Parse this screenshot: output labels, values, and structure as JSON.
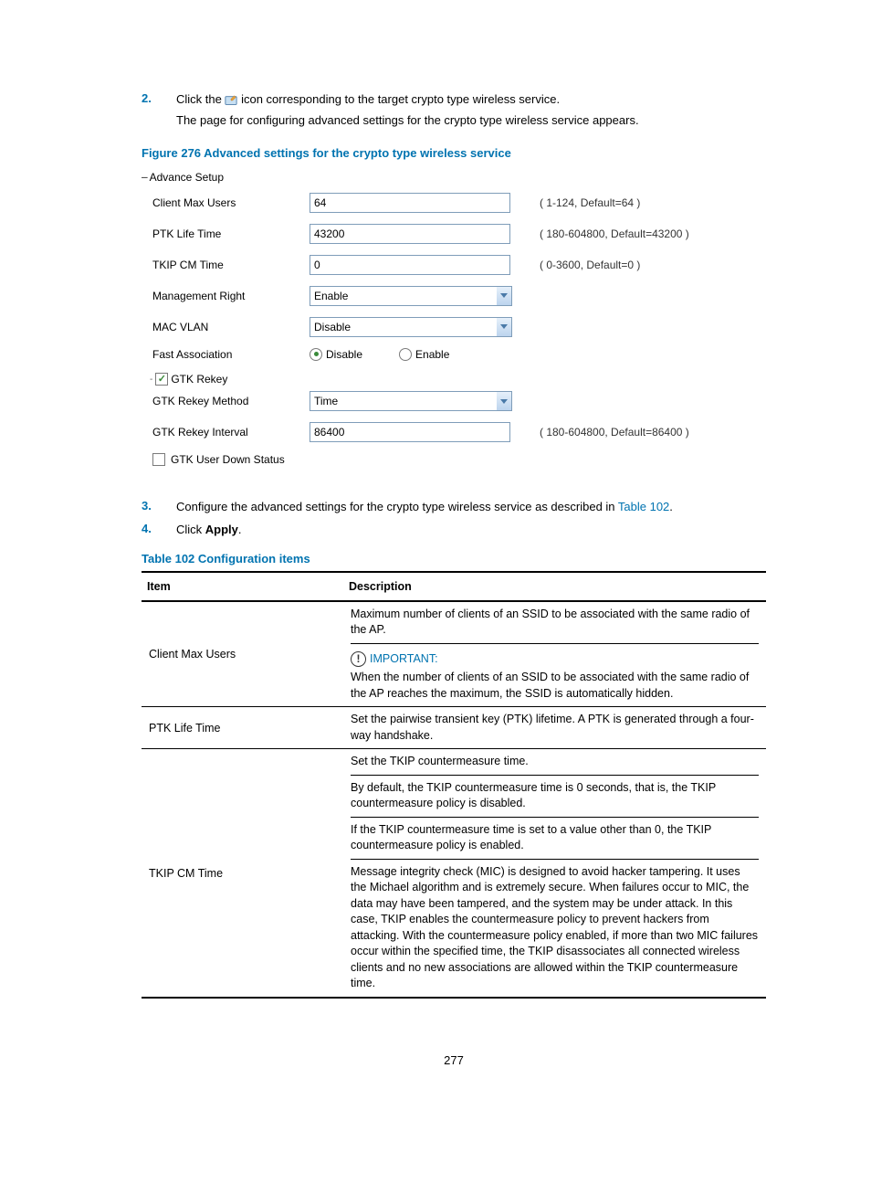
{
  "steps": {
    "s2_num": "2.",
    "s2_text_a": "Click the ",
    "s2_text_b": " icon corresponding to the target crypto type wireless service.",
    "s2_text_c": "The page for configuring advanced settings for the crypto type wireless service appears.",
    "s3_num": "3.",
    "s3_text_a": "Configure the advanced settings for the crypto type wireless service as described in ",
    "s3_link": "Table 102",
    "s3_text_b": ".",
    "s4_num": "4.",
    "s4_text_a": "Click ",
    "s4_bold": "Apply",
    "s4_text_b": "."
  },
  "figure_caption": "Figure 276 Advanced settings for the crypto type wireless service",
  "form": {
    "header": "Advance Setup",
    "client_max_label": "Client Max Users",
    "client_max_value": "64",
    "client_max_hint": "( 1-124, Default=64 )",
    "ptk_label": "PTK Life Time",
    "ptk_value": "43200",
    "ptk_hint": "( 180-604800, Default=43200 )",
    "tkip_label": "TKIP CM Time",
    "tkip_value": "0",
    "tkip_hint": "( 0-3600, Default=0 )",
    "mgmt_label": "Management Right",
    "mgmt_value": "Enable",
    "macvlan_label": "MAC VLAN",
    "macvlan_value": "Disable",
    "fast_label": "Fast Association",
    "fast_disable": "Disable",
    "fast_enable": "Enable",
    "gtk_rekey": "GTK Rekey",
    "gtk_method_label": "GTK Rekey Method",
    "gtk_method_value": "Time",
    "gtk_interval_label": "GTK Rekey Interval",
    "gtk_interval_value": "86400",
    "gtk_interval_hint": "( 180-604800, Default=86400 )",
    "gtk_down_status": "GTK User Down Status"
  },
  "table_caption": "Table 102 Configuration items",
  "table": {
    "h1": "Item",
    "h2": "Description",
    "r1_item": "Client Max Users",
    "r1_d1": "Maximum number of clients of an SSID to be associated with the same radio of the AP.",
    "r1_imp": "IMPORTANT:",
    "r1_d2": "When the number of clients of an SSID to be associated with the same radio of the AP reaches the maximum, the SSID is automatically hidden.",
    "r2_item": "PTK Life Time",
    "r2_d1": "Set the pairwise transient key (PTK) lifetime. A PTK is generated through a four-way handshake.",
    "r3_item": "TKIP CM Time",
    "r3_d1": "Set the TKIP countermeasure time.",
    "r3_d2": "By default, the TKIP countermeasure time is 0 seconds, that is, the TKIP countermeasure policy is disabled.",
    "r3_d3": "If the TKIP countermeasure time is set to a value other than 0, the TKIP countermeasure policy is enabled.",
    "r3_d4": "Message integrity check (MIC) is designed to avoid hacker tampering. It uses the Michael algorithm and is extremely secure. When failures occur to MIC, the data may have been tampered, and the system may be under attack. In this case, TKIP enables the countermeasure policy to prevent hackers from attacking. With the countermeasure policy enabled, if more than two MIC failures occur within the specified time, the TKIP disassociates all connected wireless clients and no new associations are allowed within the TKIP countermeasure time."
  },
  "page_num": "277"
}
